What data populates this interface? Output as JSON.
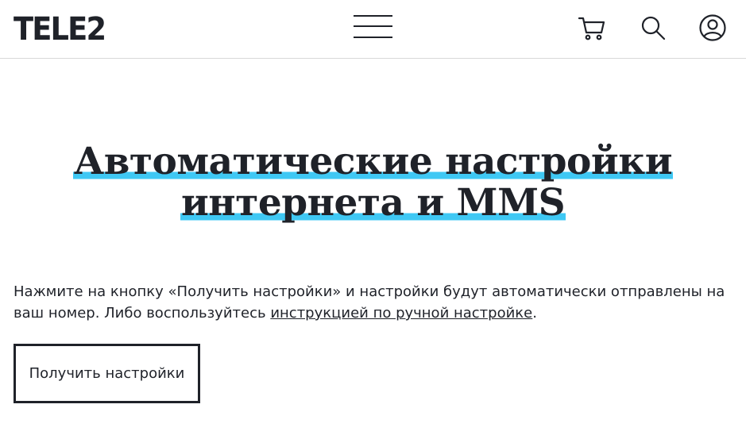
{
  "header": {
    "logo_text": "TELE2",
    "menu_icon": "hamburger-menu-icon",
    "cart_icon": "cart-icon",
    "search_icon": "search-icon",
    "user_icon": "user-icon"
  },
  "main": {
    "title_line1": "Автоматические настройки",
    "title_line2": "интернета и MMS",
    "highlight_color": "#3fc8f4",
    "description_before": "Нажмите на кнопку «Получить настройки» и настройки будут автоматически отправлены на ваш номер. Либо воспользуйтесь ",
    "description_link": "инструкцией по ручной настройке",
    "description_after": ".",
    "cta_label": "Получить настройки"
  }
}
